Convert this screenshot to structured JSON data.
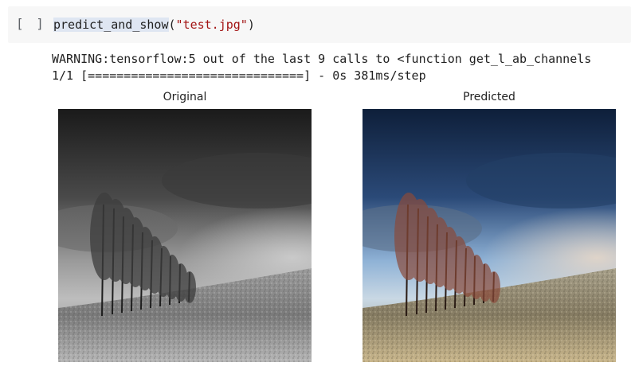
{
  "cell": {
    "run_indicator": "[ ]",
    "code": {
      "function_name": "predict_and_show",
      "open_paren": "(",
      "argument": "\"test.jpg\"",
      "close_paren": ")"
    }
  },
  "output": {
    "lines": [
      "WARNING:tensorflow:5 out of the last 9 calls to <function get_l_ab_channels",
      "1/1 [==============================] - 0s 381ms/step"
    ]
  },
  "figures": {
    "original": {
      "title": "Original"
    },
    "predicted": {
      "title": "Predicted"
    }
  },
  "colors": {
    "cell_background": "#f7f7f7",
    "string_color": "#a31515",
    "function_highlight": "#dfe6f2"
  }
}
